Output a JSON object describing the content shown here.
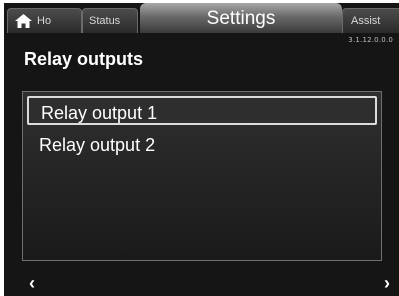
{
  "tabs": {
    "home_label": "Ho",
    "status_label": "Status",
    "settings_label": "Settings",
    "assist_label": "Assist"
  },
  "version": "3.1.12.0.0.0",
  "page_title": "Relay outputs",
  "list": {
    "items": [
      {
        "label": "Relay output 1",
        "selected": true
      },
      {
        "label": "Relay output 2",
        "selected": false
      }
    ]
  },
  "nav": {
    "prev_icon": "‹",
    "next_icon": "›"
  },
  "icons": {
    "home": "home-icon"
  }
}
